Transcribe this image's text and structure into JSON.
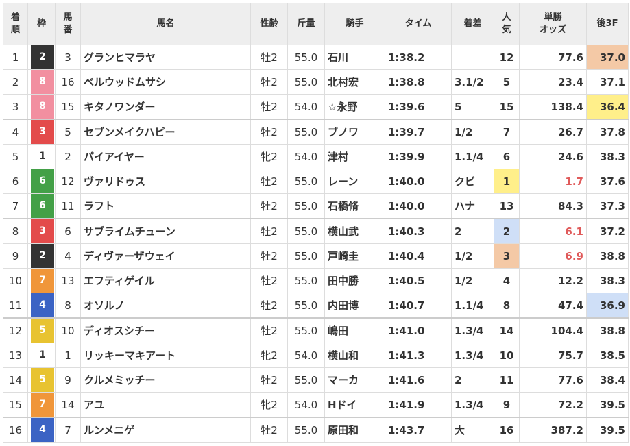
{
  "headers": {
    "rank": [
      "着",
      "順"
    ],
    "waku": "枠",
    "umaban": [
      "馬",
      "番"
    ],
    "horse": "馬名",
    "sexage": "性齢",
    "weight": "斤量",
    "jockey": "騎手",
    "time": "タイム",
    "margin": "着差",
    "pop": [
      "人",
      "気"
    ],
    "odds": [
      "単勝",
      "オッズ"
    ],
    "last3f": "後3F"
  },
  "waku_colors": {
    "1": {
      "bg": "#ffffff",
      "fg": "#333333"
    },
    "2": {
      "bg": "#333333",
      "fg": "#ffffff"
    },
    "3": {
      "bg": "#e34b4b",
      "fg": "#ffffff"
    },
    "4": {
      "bg": "#3b63c4",
      "fg": "#ffffff"
    },
    "5": {
      "bg": "#e8c331",
      "fg": "#ffffff"
    },
    "6": {
      "bg": "#43a047",
      "fg": "#ffffff"
    },
    "7": {
      "bg": "#f0963a",
      "fg": "#ffffff"
    },
    "8": {
      "bg": "#f28fa0",
      "fg": "#ffffff"
    }
  },
  "rows": [
    {
      "rank": "1",
      "waku": "2",
      "umaban": "3",
      "horse": "グランヒマラヤ",
      "sexage": "牡2",
      "weight": "55.0",
      "jockey": "石川",
      "time": "1:38.2",
      "margin": "",
      "pop": "12",
      "odds": "77.6",
      "last3f": "37.0",
      "popHL": 0,
      "fHL": 1,
      "sep": false
    },
    {
      "rank": "2",
      "waku": "8",
      "umaban": "16",
      "horse": "ベルウッドムサシ",
      "sexage": "牡2",
      "weight": "55.0",
      "jockey": "北村宏",
      "time": "1:38.8",
      "margin": "3.1/2",
      "pop": "5",
      "odds": "23.4",
      "last3f": "37.1",
      "popHL": 0,
      "fHL": 0,
      "sep": false
    },
    {
      "rank": "3",
      "waku": "8",
      "umaban": "15",
      "horse": "キタノワンダー",
      "sexage": "牡2",
      "weight": "54.0",
      "jockey": "☆永野",
      "time": "1:39.6",
      "margin": "5",
      "pop": "15",
      "odds": "138.4",
      "last3f": "36.4",
      "popHL": 0,
      "fHL": 2,
      "sep": false
    },
    {
      "rank": "4",
      "waku": "3",
      "umaban": "5",
      "horse": "セブンメイクハピー",
      "sexage": "牡2",
      "weight": "55.0",
      "jockey": "ブノワ",
      "time": "1:39.7",
      "margin": "1/2",
      "pop": "7",
      "odds": "26.7",
      "last3f": "37.8",
      "popHL": 0,
      "fHL": 0,
      "sep": true
    },
    {
      "rank": "5",
      "waku": "1",
      "umaban": "2",
      "horse": "パイアイヤー",
      "sexage": "牝2",
      "weight": "54.0",
      "jockey": "津村",
      "time": "1:39.9",
      "margin": "1.1/4",
      "pop": "6",
      "odds": "24.6",
      "last3f": "38.3",
      "popHL": 0,
      "fHL": 0,
      "sep": false
    },
    {
      "rank": "6",
      "waku": "6",
      "umaban": "12",
      "horse": "ヴァリドゥス",
      "sexage": "牡2",
      "weight": "55.0",
      "jockey": "レーン",
      "time": "1:40.0",
      "margin": "クビ",
      "pop": "1",
      "odds": "1.7",
      "last3f": "37.6",
      "popHL": 1,
      "fHL": 0,
      "sep": false
    },
    {
      "rank": "7",
      "waku": "6",
      "umaban": "11",
      "horse": "ラフト",
      "sexage": "牡2",
      "weight": "55.0",
      "jockey": "石橋脩",
      "time": "1:40.0",
      "margin": "ハナ",
      "pop": "13",
      "odds": "84.3",
      "last3f": "37.3",
      "popHL": 0,
      "fHL": 0,
      "sep": false
    },
    {
      "rank": "8",
      "waku": "3",
      "umaban": "6",
      "horse": "サブライムチューン",
      "sexage": "牡2",
      "weight": "55.0",
      "jockey": "横山武",
      "time": "1:40.3",
      "margin": "2",
      "pop": "2",
      "odds": "6.1",
      "last3f": "37.2",
      "popHL": 2,
      "fHL": 0,
      "sep": true
    },
    {
      "rank": "9",
      "waku": "2",
      "umaban": "4",
      "horse": "ディヴァーザウェイ",
      "sexage": "牡2",
      "weight": "55.0",
      "jockey": "戸崎圭",
      "time": "1:40.4",
      "margin": "1/2",
      "pop": "3",
      "odds": "6.9",
      "last3f": "38.8",
      "popHL": 3,
      "fHL": 0,
      "sep": false
    },
    {
      "rank": "10",
      "waku": "7",
      "umaban": "13",
      "horse": "エフティゲイル",
      "sexage": "牡2",
      "weight": "55.0",
      "jockey": "田中勝",
      "time": "1:40.5",
      "margin": "1/2",
      "pop": "4",
      "odds": "12.2",
      "last3f": "38.3",
      "popHL": 0,
      "fHL": 0,
      "sep": false
    },
    {
      "rank": "11",
      "waku": "4",
      "umaban": "8",
      "horse": "オソルノ",
      "sexage": "牡2",
      "weight": "55.0",
      "jockey": "内田博",
      "time": "1:40.7",
      "margin": "1.1/4",
      "pop": "8",
      "odds": "47.4",
      "last3f": "36.9",
      "popHL": 0,
      "fHL": 3,
      "sep": false
    },
    {
      "rank": "12",
      "waku": "5",
      "umaban": "10",
      "horse": "ディオスシチー",
      "sexage": "牡2",
      "weight": "55.0",
      "jockey": "嶋田",
      "time": "1:41.0",
      "margin": "1.3/4",
      "pop": "14",
      "odds": "104.4",
      "last3f": "38.8",
      "popHL": 0,
      "fHL": 0,
      "sep": true
    },
    {
      "rank": "13",
      "waku": "1",
      "umaban": "1",
      "horse": "リッキーマキアート",
      "sexage": "牝2",
      "weight": "54.0",
      "jockey": "横山和",
      "time": "1:41.3",
      "margin": "1.3/4",
      "pop": "10",
      "odds": "75.7",
      "last3f": "38.5",
      "popHL": 0,
      "fHL": 0,
      "sep": false
    },
    {
      "rank": "14",
      "waku": "5",
      "umaban": "9",
      "horse": "クルメミッチー",
      "sexage": "牡2",
      "weight": "55.0",
      "jockey": "マーカ",
      "time": "1:41.6",
      "margin": "2",
      "pop": "11",
      "odds": "77.6",
      "last3f": "38.4",
      "popHL": 0,
      "fHL": 0,
      "sep": false
    },
    {
      "rank": "15",
      "waku": "7",
      "umaban": "14",
      "horse": "アユ",
      "sexage": "牝2",
      "weight": "54.0",
      "jockey": "Hドイ",
      "time": "1:41.9",
      "margin": "1.3/4",
      "pop": "9",
      "odds": "72.2",
      "last3f": "39.5",
      "popHL": 0,
      "fHL": 0,
      "sep": false
    },
    {
      "rank": "16",
      "waku": "4",
      "umaban": "7",
      "horse": "ルンメニゲ",
      "sexage": "牡2",
      "weight": "55.0",
      "jockey": "原田和",
      "time": "1:43.7",
      "margin": "大",
      "pop": "16",
      "odds": "387.2",
      "last3f": "39.5",
      "popHL": 0,
      "fHL": 0,
      "sep": true
    }
  ]
}
